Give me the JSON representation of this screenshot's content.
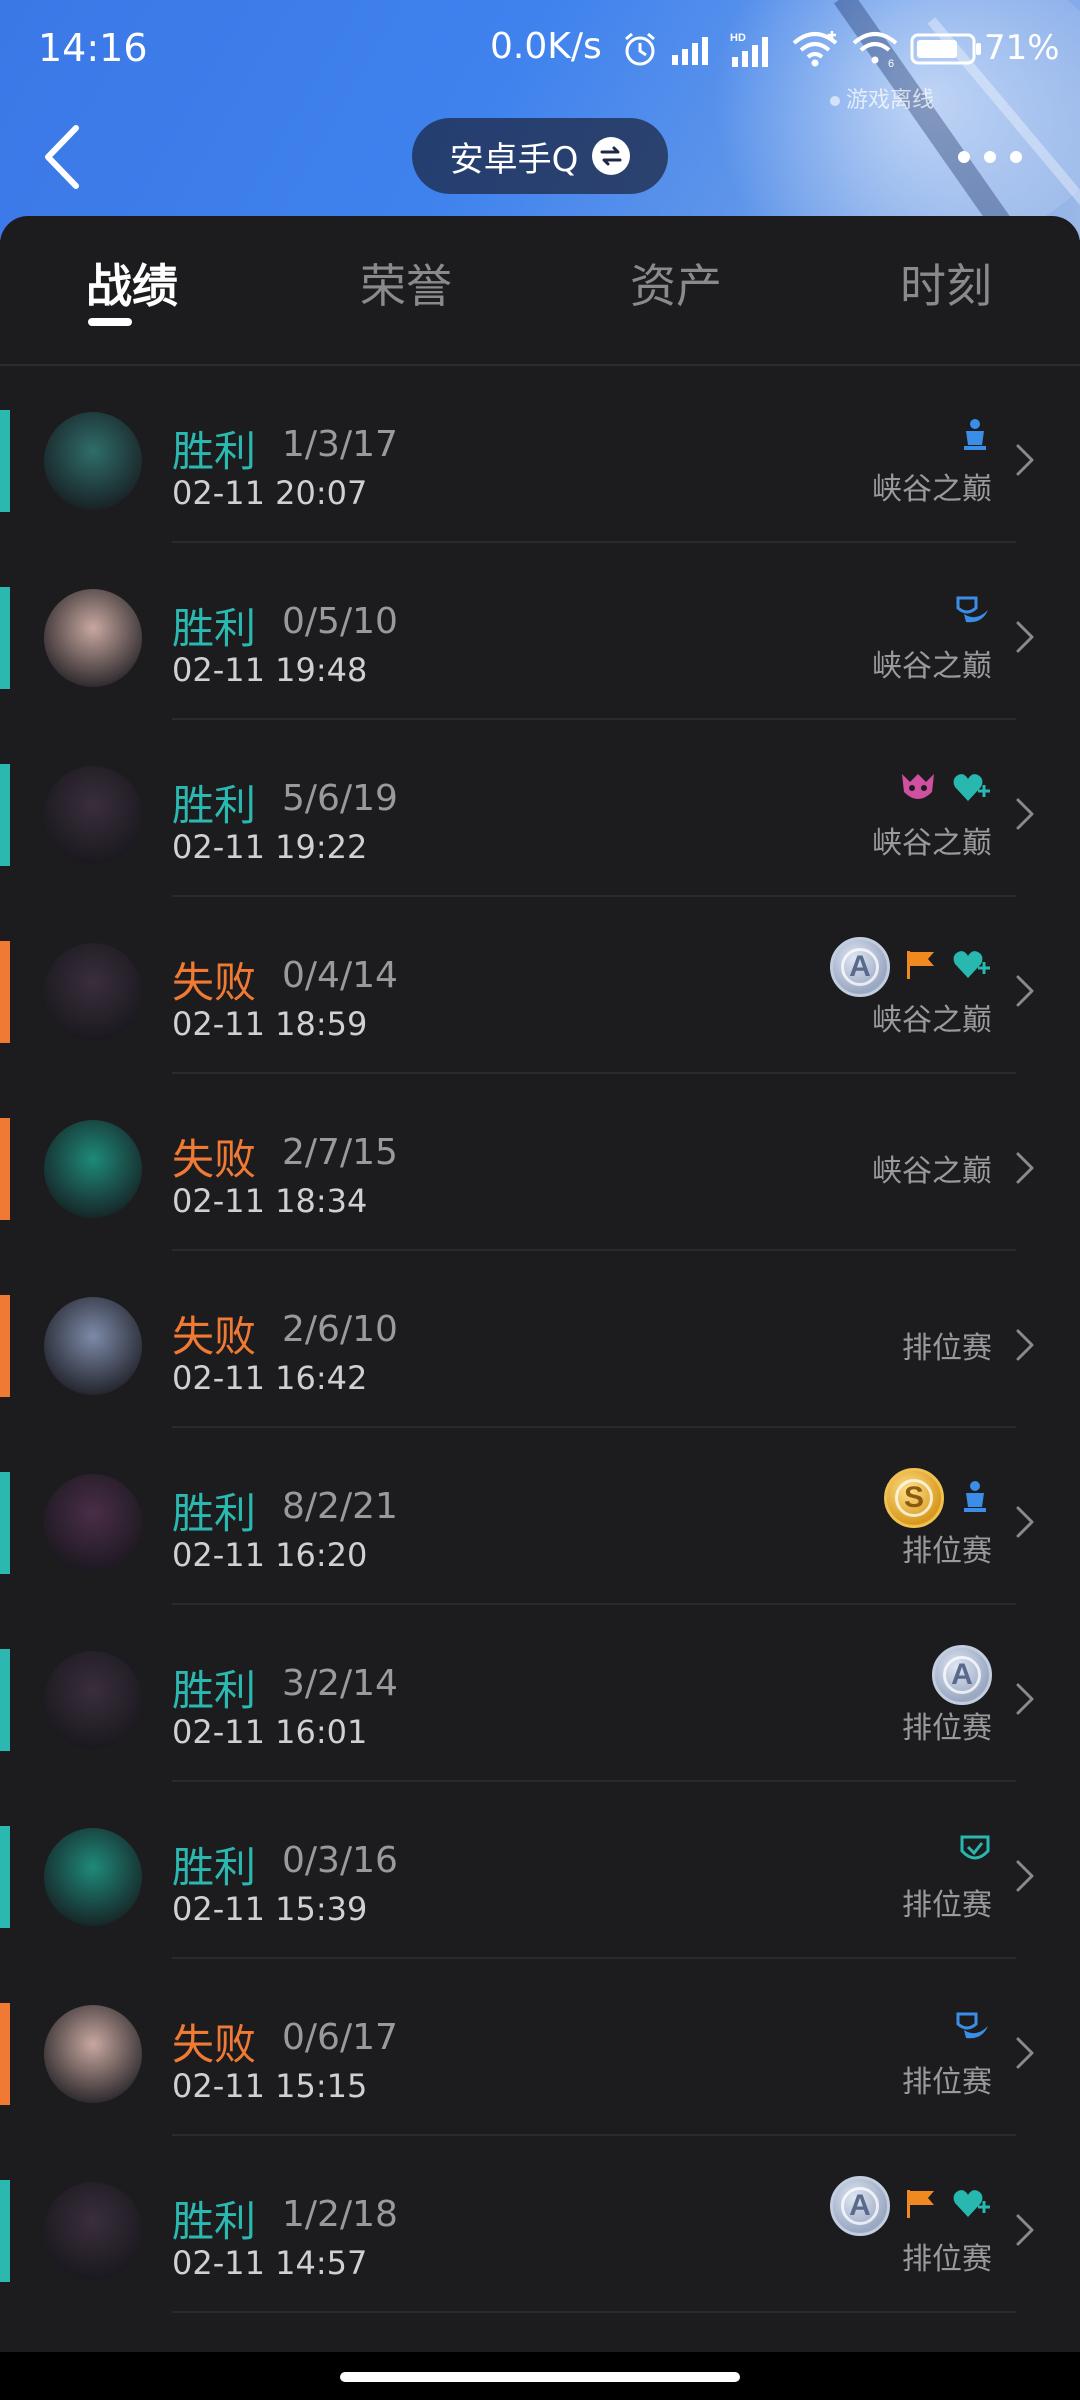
{
  "status_bar": {
    "time": "14:16",
    "network_speed": "0.0K/s",
    "battery": "71%",
    "icons": [
      "alarm-icon",
      "signal-icon",
      "hd-signal-icon",
      "wifi-icon",
      "wifi-6-icon",
      "battery-icon"
    ]
  },
  "header": {
    "title": "安卓手Q",
    "game_status": "游戏离线"
  },
  "tabs": [
    {
      "label": "战绩",
      "active": true
    },
    {
      "label": "荣誉",
      "active": false
    },
    {
      "label": "资产",
      "active": false
    },
    {
      "label": "时刻",
      "active": false
    }
  ],
  "matches": [
    {
      "result": "胜利",
      "outcome": "win",
      "kda": "1/3/17",
      "datetime": "02-11 20:07",
      "mode": "峡谷之巅",
      "badges": [
        "mvp-figure-icon"
      ],
      "avatar_color": "#2f6e6a"
    },
    {
      "result": "胜利",
      "outcome": "win",
      "kda": "0/5/10",
      "datetime": "02-11 19:48",
      "mode": "峡谷之巅",
      "badges": [
        "shield-wing-icon"
      ],
      "avatar_color": "#c8a8a0"
    },
    {
      "result": "胜利",
      "outcome": "win",
      "kda": "5/6/19",
      "datetime": "02-11 19:22",
      "mode": "峡谷之巅",
      "badges": [
        "demon-face-icon",
        "heart-plus-icon"
      ],
      "avatar_color": "#3a2e3c"
    },
    {
      "result": "失败",
      "outcome": "loss",
      "kda": "0/4/14",
      "datetime": "02-11 18:59",
      "mode": "峡谷之巅",
      "badges": [
        "medal-a",
        "flag-icon",
        "heart-plus-icon"
      ],
      "avatar_color": "#3a2e3c"
    },
    {
      "result": "失败",
      "outcome": "loss",
      "kda": "2/7/15",
      "datetime": "02-11 18:34",
      "mode": "峡谷之巅",
      "badges": [],
      "avatar_color": "#1e8a7a"
    },
    {
      "result": "失败",
      "outcome": "loss",
      "kda": "2/6/10",
      "datetime": "02-11 16:42",
      "mode": "排位赛",
      "badges": [],
      "avatar_color": "#7d8aa8"
    },
    {
      "result": "胜利",
      "outcome": "win",
      "kda": "8/2/21",
      "datetime": "02-11 16:20",
      "mode": "排位赛",
      "badges": [
        "medal-s",
        "mvp-figure-icon"
      ],
      "avatar_color": "#4a2e48"
    },
    {
      "result": "胜利",
      "outcome": "win",
      "kda": "3/2/14",
      "datetime": "02-11 16:01",
      "mode": "排位赛",
      "badges": [
        "medal-a"
      ],
      "avatar_color": "#3a2e3c"
    },
    {
      "result": "胜利",
      "outcome": "win",
      "kda": "0/3/16",
      "datetime": "02-11 15:39",
      "mode": "排位赛",
      "badges": [
        "shield-check-icon"
      ],
      "avatar_color": "#1e8a7a"
    },
    {
      "result": "失败",
      "outcome": "loss",
      "kda": "0/6/17",
      "datetime": "02-11 15:15",
      "mode": "排位赛",
      "badges": [
        "shield-wing-icon"
      ],
      "avatar_color": "#c8a8a0"
    },
    {
      "result": "胜利",
      "outcome": "win",
      "kda": "1/2/18",
      "datetime": "02-11 14:57",
      "mode": "排位赛",
      "badges": [
        "medal-a",
        "flag-icon",
        "heart-plus-icon"
      ],
      "avatar_color": "#3a2e3c"
    }
  ],
  "colors": {
    "win": "#2bb8b0",
    "loss": "#f07a34",
    "background": "#1c1c1e",
    "header_blue": "#3f82ee"
  }
}
